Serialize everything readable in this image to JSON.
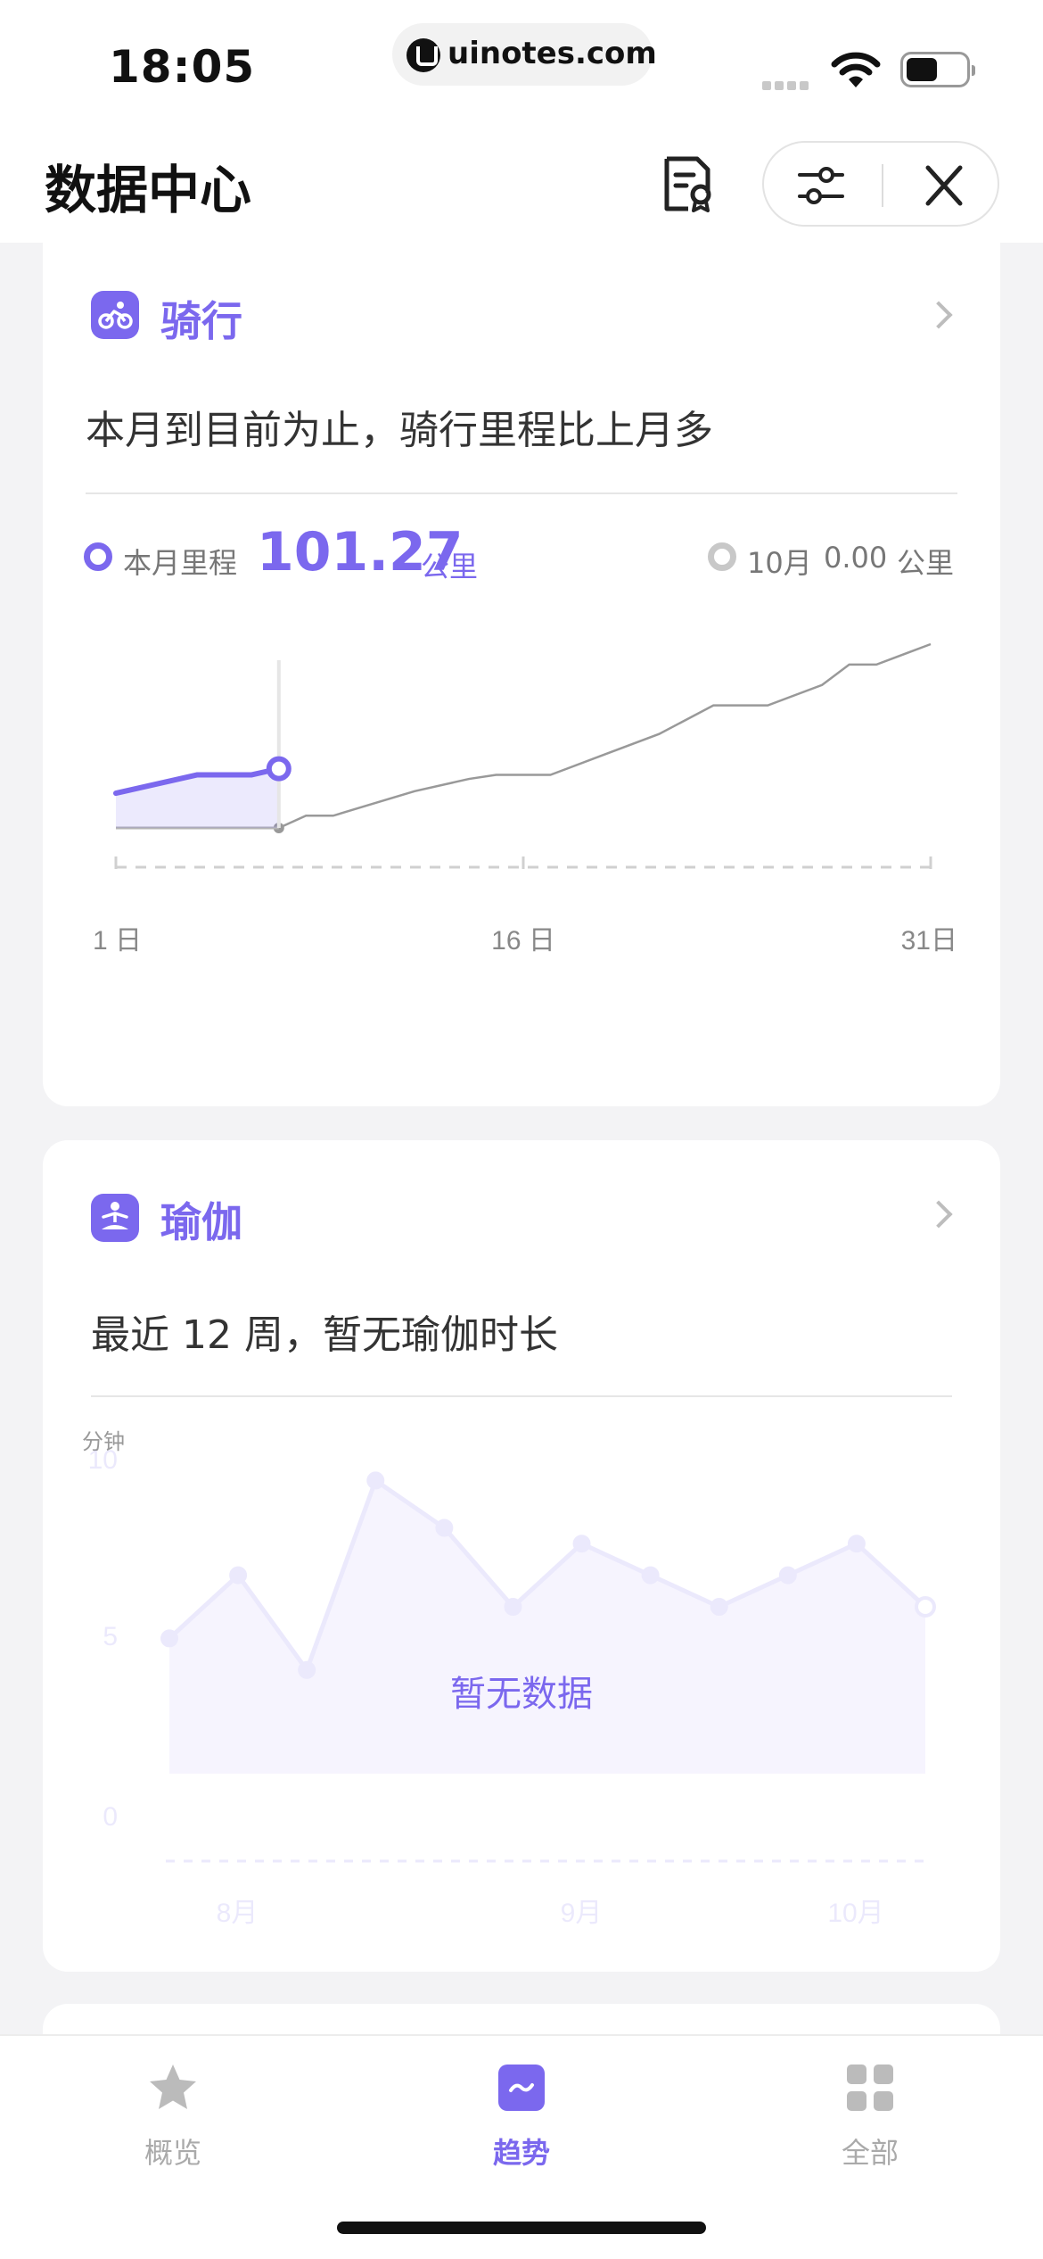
{
  "status_bar": {
    "time": "18:05",
    "url": "uinotes.com"
  },
  "header": {
    "title": "数据中心"
  },
  "colors": {
    "accent": "#7b68ee",
    "previous_series": "#999999"
  },
  "cycling": {
    "title": "骑行",
    "summary": "本月到目前为止，骑行里程比上月多",
    "current_label": "本月里程",
    "current_value": "101.27",
    "current_unit": "公里",
    "previous_label": "10月",
    "previous_value": "0.00",
    "previous_unit": "公里",
    "x_labels": [
      "1 日",
      "16 日",
      "31日"
    ]
  },
  "yoga": {
    "title": "瑜伽",
    "summary": "最近 12 周，暂无瑜伽时长",
    "y_unit": "分钟",
    "y_ticks": [
      "10",
      "5",
      "0"
    ],
    "x_labels": [
      "8月",
      "9月",
      "10月"
    ],
    "no_data": "暂无数据"
  },
  "tabs": [
    {
      "label": "概览",
      "icon": "star-icon"
    },
    {
      "label": "趋势",
      "icon": "trend-icon"
    },
    {
      "label": "全部",
      "icon": "grid-icon"
    }
  ],
  "chart_data": [
    {
      "type": "line",
      "x_unit": "日",
      "xlim": [
        1,
        31
      ],
      "series": [
        {
          "name": "本月里程",
          "color": "#7b68ee",
          "x": [
            1,
            4,
            5,
            6,
            7
          ],
          "y": [
            8.5,
            13,
            13,
            13,
            14.5
          ]
        },
        {
          "name": "10月",
          "color": "#999999",
          "x": [
            7,
            8,
            9,
            10,
            12,
            14,
            15,
            17,
            19,
            21,
            23,
            25,
            27,
            28,
            29,
            31
          ],
          "y": [
            0,
            3,
            3,
            5,
            9,
            12,
            13,
            13,
            18,
            23,
            30,
            30,
            35,
            40,
            40,
            45
          ]
        }
      ]
    },
    {
      "type": "area",
      "ylabel": "分钟",
      "ylim": [
        0,
        10
      ],
      "x_ticks": [
        "8月",
        "9月",
        "10月"
      ],
      "series": [
        {
          "values": [
            4,
            6,
            3,
            9,
            7.5,
            5,
            7,
            6,
            5,
            6,
            7,
            5
          ]
        }
      ]
    }
  ]
}
